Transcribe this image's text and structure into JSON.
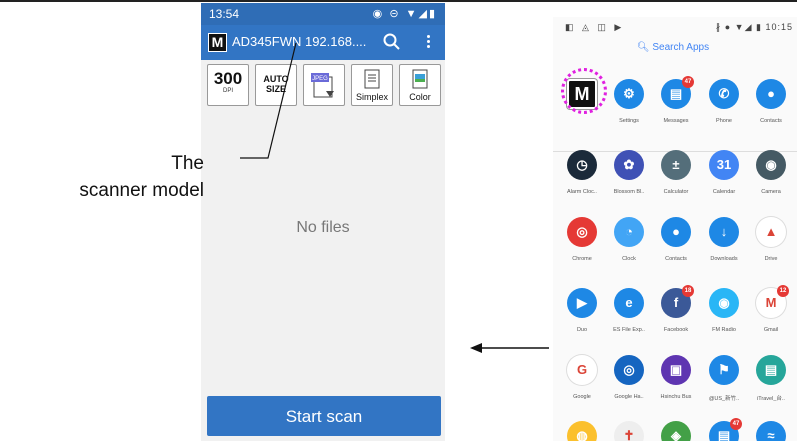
{
  "left_phone": {
    "status_time": "13:54",
    "status_icons": "◉ ⊝ ▼◢▮",
    "device_label": "AD345FWN 192.168....",
    "tools": {
      "dpi_value": "300",
      "dpi_unit": "DPI",
      "autosize_line1": "AUTO",
      "autosize_line2": "SIZE",
      "jpeg_label": "JPEG",
      "simplex_label": "Simplex",
      "color_label": "Color"
    },
    "empty_text": "No files",
    "start_button": "Start scan"
  },
  "annotation": {
    "line1": "The",
    "line2": "scanner model"
  },
  "right_phone": {
    "status_left": "◧ ◬ ◫ ▶",
    "status_right": "∦ ● ▼◢ ▮ 10:15",
    "search_placeholder": "Search Apps",
    "apps": [
      {
        "label": "",
        "color": "#111111"
      },
      {
        "label": "Settings",
        "color": "#1e88e5"
      },
      {
        "label": "Messages",
        "color": "#1e88e5",
        "badge": "47"
      },
      {
        "label": "Phone",
        "color": "#1e88e5"
      },
      {
        "label": "Contacts",
        "color": "#1e88e5"
      },
      {
        "label": "Alarm Cloc..",
        "color": "#1b2a3a"
      },
      {
        "label": "Blossom Bl..",
        "color": "#3f51b5"
      },
      {
        "label": "Calculator",
        "color": "#546e7a"
      },
      {
        "label": "Calendar",
        "color": "#4285f4"
      },
      {
        "label": "Camera",
        "color": "#455a64"
      },
      {
        "label": "Chrome",
        "color": "#e53935"
      },
      {
        "label": "Clock",
        "color": "#42a5f5"
      },
      {
        "label": "Contacts",
        "color": "#1e88e5"
      },
      {
        "label": "Downloads",
        "color": "#1e88e5"
      },
      {
        "label": "Drive",
        "color": "#ffffff"
      },
      {
        "label": "Duo",
        "color": "#1e88e5"
      },
      {
        "label": "ES File Exp..",
        "color": "#1e88e5"
      },
      {
        "label": "Facebook",
        "color": "#3b5998",
        "badge": "18"
      },
      {
        "label": "FM Radio",
        "color": "#29b6f6"
      },
      {
        "label": "Gmail",
        "color": "#ffffff",
        "badge": "12"
      },
      {
        "label": "Google",
        "color": "#ffffff"
      },
      {
        "label": "Google Ha..",
        "color": "#1565c0"
      },
      {
        "label": "Hsinchu Bus",
        "color": "#5e35b1"
      },
      {
        "label": "@US_新竹..",
        "color": "#1e88e5"
      },
      {
        "label": "iTravel_台..",
        "color": "#26a69a"
      },
      {
        "label": "",
        "color": "#fbc02d"
      },
      {
        "label": "",
        "color": "#eeeeee"
      },
      {
        "label": "",
        "color": "#43a047"
      },
      {
        "label": "",
        "color": "#1e88e5",
        "badge": "47"
      },
      {
        "label": "",
        "color": "#1e88e5"
      }
    ],
    "app_glyphs": [
      "M",
      "⚙",
      "▤",
      "✆",
      "●",
      "◷",
      "✿",
      "±",
      "31",
      "◉",
      "◎",
      "◔",
      "●",
      "↓",
      "▲",
      "▶",
      "e",
      "f",
      "◉",
      "M",
      "G",
      "◎",
      "▣",
      "⚑",
      "▤",
      "◍",
      "✝",
      "◈",
      "▤",
      "≈"
    ]
  }
}
